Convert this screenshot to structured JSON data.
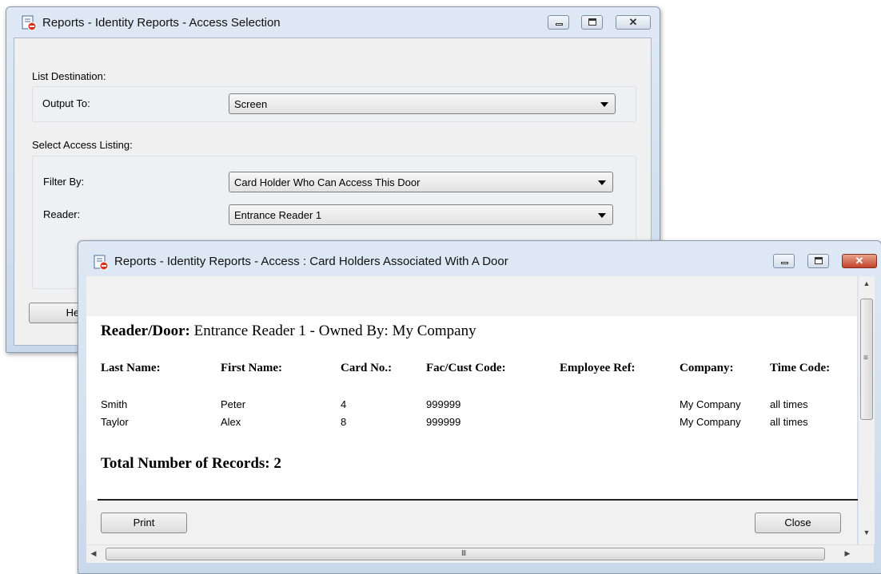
{
  "access_selection_window": {
    "title": "Reports - Identity Reports - Access Selection",
    "list_destination_label": "List Destination:",
    "output_to_label": "Output To:",
    "output_to_value": "Screen",
    "select_access_listing_label": "Select Access Listing:",
    "filter_by_label": "Filter By:",
    "filter_by_value": "Card Holder Who Can Access This Door",
    "reader_label": "Reader:",
    "reader_value": "Entrance Reader 1",
    "help_button_label": "Help"
  },
  "report_window": {
    "title": "Reports - Identity Reports - Access : Card Holders Associated With A Door",
    "reader_door_label": "Reader/Door:",
    "reader_door_value": "Entrance Reader 1 - Owned By: My Company",
    "columns": [
      "Last Name:",
      "First Name:",
      "Card No.:",
      "Fac/Cust Code:",
      "Employee Ref:",
      "Company:",
      "Time Code:"
    ],
    "rows": [
      {
        "last_name": "Smith",
        "first_name": "Peter",
        "card_no": "4",
        "fac_cust_code": "999999",
        "employee_ref": "",
        "company": "My Company",
        "time_code": "all times"
      },
      {
        "last_name": "Taylor",
        "first_name": "Alex",
        "card_no": "8",
        "fac_cust_code": "999999",
        "employee_ref": "",
        "company": "My Company",
        "time_code": "all times"
      }
    ],
    "total_label": "Total Number of Records: 2",
    "print_button_label": "Print",
    "close_button_label": "Close",
    "hscroll_grip": "III"
  },
  "colors": {
    "title_bar": "#dfe9f5",
    "client_bg": "#f0f0f0",
    "close_button": "#c2442a"
  }
}
